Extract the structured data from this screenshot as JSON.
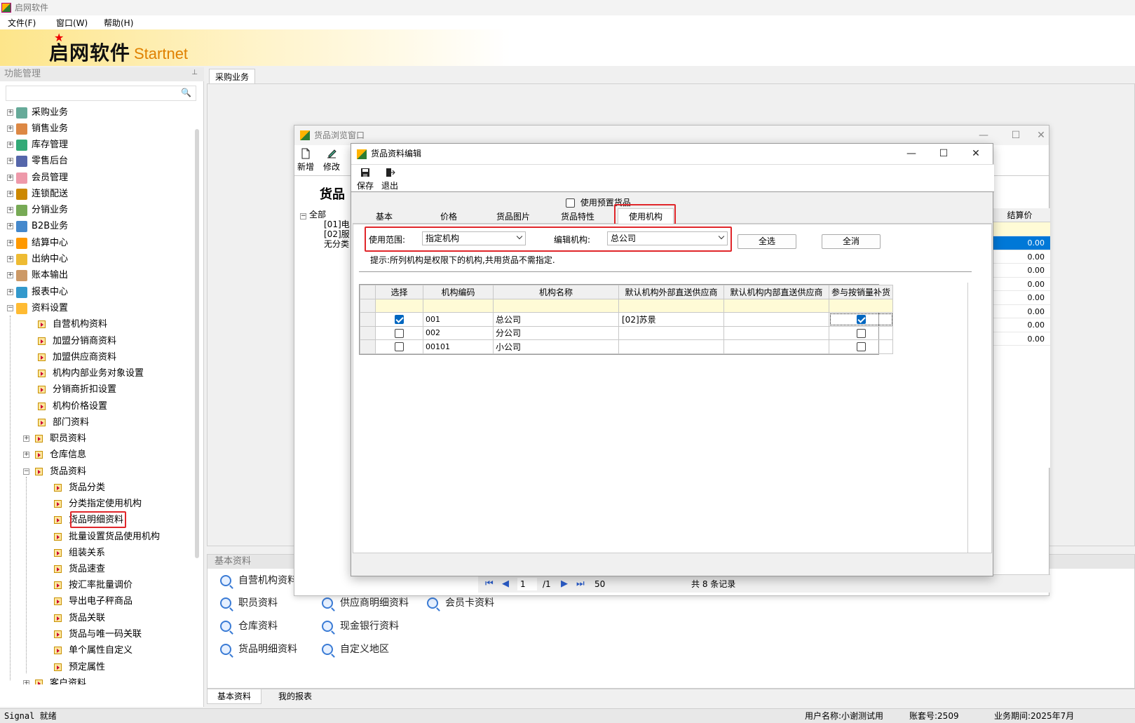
{
  "app": {
    "title": "启网软件",
    "logo_cn": "启网软件",
    "logo_en": "Startnet"
  },
  "menu": [
    "文件(F)",
    "窗口(W)",
    "帮助(H)"
  ],
  "left_panel": {
    "title": "功能管理",
    "top_items": [
      "采购业务",
      "销售业务",
      "库存管理",
      "零售后台",
      "会员管理",
      "连锁配送",
      "分销业务",
      "B2B业务",
      "结算中心",
      "出纳中心",
      "账本输出",
      "报表中心",
      "资料设置"
    ],
    "sub_items": [
      "自营机构资料",
      "加盟分销商资料",
      "加盟供应商资料",
      "机构内部业务对象设置",
      "分销商折扣设置",
      "机构价格设置",
      "部门资料",
      "职员资料",
      "仓库信息",
      "货品资料"
    ],
    "goods_items": [
      "货品分类",
      "分类指定使用机构",
      "货品明细资料",
      "批量设置货品使用机构",
      "组装关系",
      "货品速查",
      "按汇率批量调价",
      "导出电子秤商品",
      "货品关联",
      "货品与唯一码关联",
      "单个属性自定义",
      "预定属性"
    ],
    "last_item": "客户资料"
  },
  "main_tab": "采购业务",
  "basic_panel": {
    "title": "基本资料",
    "links": [
      "自营机构资料",
      "职员资料",
      "供应商明细资料",
      "会员卡资料",
      "仓库资料",
      "现金银行资料",
      "货品明细资料",
      "自定义地区"
    ]
  },
  "bottom_tabs": [
    "基本资料",
    "我的报表"
  ],
  "status": {
    "left": "Signal 就绪",
    "user": "用户名称:小谢测试用",
    "account": "账套号:2509",
    "period": "业务期间:2025年7月"
  },
  "browse_window": {
    "title": "货品浏览窗口",
    "toolbar": [
      "新增",
      "修改"
    ],
    "heading": "货品",
    "tree": [
      "全部",
      "[01]电",
      "[02]服",
      "无分类"
    ],
    "price_col": "结算价",
    "prices": [
      "0.00",
      "0.00",
      "0.00",
      "0.00",
      "0.00",
      "0.00",
      "0.00",
      "0.00"
    ],
    "pager": {
      "page": "1",
      "total_pages": "/1",
      "page_size": "50",
      "summary": "共 8 条记录"
    }
  },
  "edit_dialog": {
    "title": "货品资料编辑",
    "toolbar": [
      "保存",
      "退出"
    ],
    "preset_label": "使用预置货品",
    "tabs": [
      "基本",
      "价格",
      "货品图片",
      "货品特性",
      "使用机构"
    ],
    "scope_label": "使用范围:",
    "scope_value": "指定机构",
    "org_label": "编辑机构:",
    "org_value": "总公司",
    "select_all": "全选",
    "clear_all": "全消",
    "hint": "提示:所列机构是权限下的机构,共用货品不需指定.",
    "grid_headers": [
      "选择",
      "机构编码",
      "机构名称",
      "默认机构外部直送供应商",
      "默认机构内部直送供应商",
      "参与按销量补货"
    ],
    "rows": [
      {
        "selected": true,
        "code": "001",
        "name": "总公司",
        "ext_supplier": "[02]苏景",
        "int_supplier": "",
        "replenish": true
      },
      {
        "selected": false,
        "code": "002",
        "name": "分公司",
        "ext_supplier": "",
        "int_supplier": "",
        "replenish": false
      },
      {
        "selected": false,
        "code": "00101",
        "name": "小公司",
        "ext_supplier": "",
        "int_supplier": "",
        "replenish": false
      }
    ]
  }
}
